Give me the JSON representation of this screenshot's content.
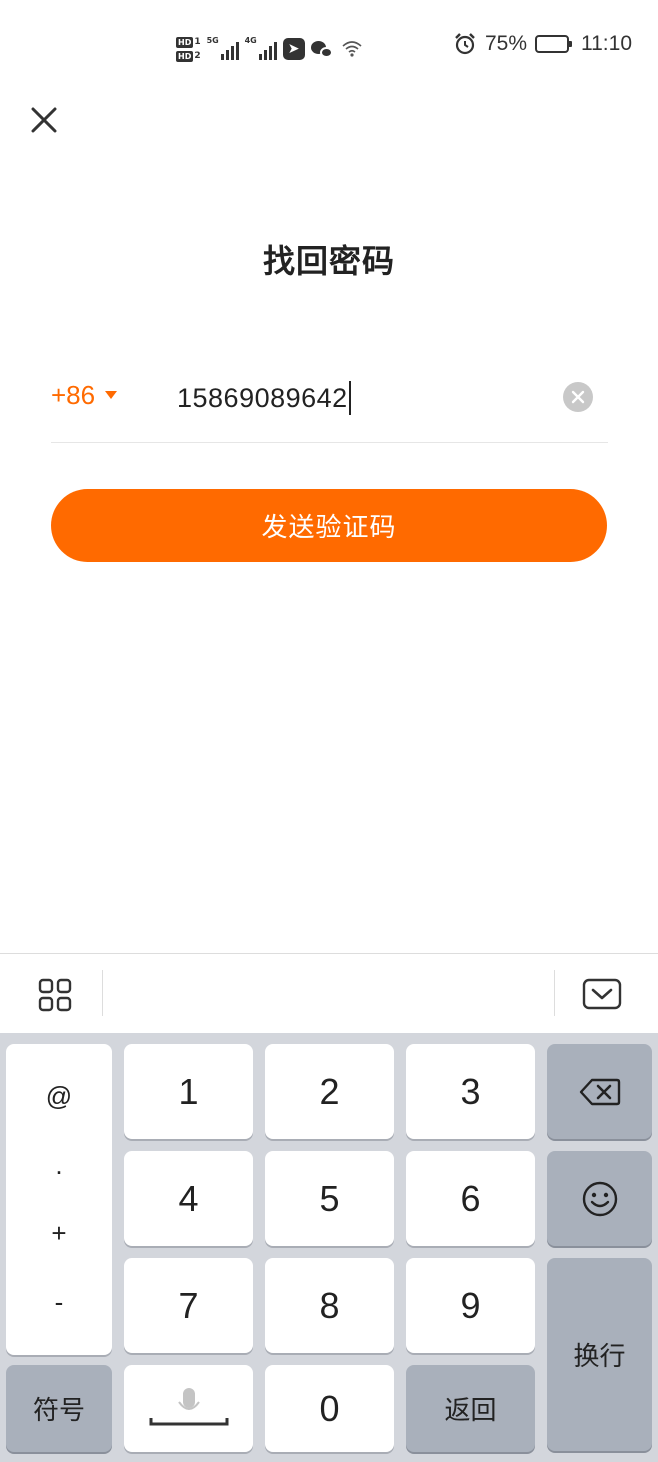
{
  "status_bar": {
    "hd1_label": "HD",
    "hd1_num": "1",
    "hd2_label": "HD",
    "hd2_num": "2",
    "signal1_tech": "5G",
    "signal2_tech": "4G",
    "battery_percent": "75%",
    "battery_level": 0.75,
    "time": "11:10",
    "icons": [
      "alarm-icon",
      "battery-icon",
      "wifi-icon",
      "wechat-icon",
      "app-icon"
    ]
  },
  "page": {
    "title": "找回密码",
    "country_code": "+86",
    "phone_value": "15869089642",
    "send_button_label": "发送验证码"
  },
  "colors": {
    "accent": "#ff6a00",
    "keyboard_bg": "#d3d6dc",
    "function_key": "#a9b0bb"
  },
  "keyboard": {
    "symbol_column": [
      "@",
      ".",
      "+",
      "-"
    ],
    "digits": [
      "1",
      "2",
      "3",
      "4",
      "5",
      "6",
      "7",
      "8",
      "9",
      "0"
    ],
    "symbols_key": "符号",
    "back_key": "返回",
    "enter_key": "换行"
  }
}
